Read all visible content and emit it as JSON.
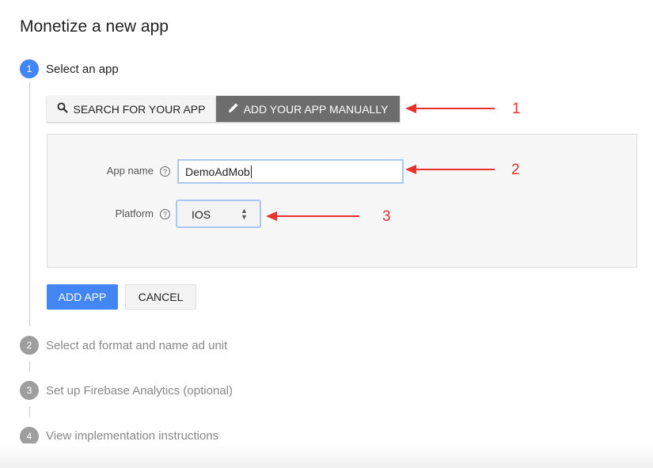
{
  "title": "Monetize a new app",
  "steps": [
    {
      "number": "1",
      "label": "Select an app",
      "active": true
    },
    {
      "number": "2",
      "label": "Select ad format and name ad unit"
    },
    {
      "number": "3",
      "label": "Set up Firebase Analytics (optional)"
    },
    {
      "number": "4",
      "label": "View implementation instructions"
    }
  ],
  "tabs": {
    "search": "SEARCH FOR YOUR APP",
    "manual": "ADD YOUR APP MANUALLY"
  },
  "form": {
    "app_name_label": "App name",
    "app_name_value": "DemoAdMob",
    "platform_label": "Platform",
    "platform_value": "IOS",
    "help": "?"
  },
  "buttons": {
    "add": "ADD APP",
    "cancel": "CANCEL"
  },
  "annotations": [
    "1",
    "2",
    "3"
  ],
  "colors": {
    "accent": "#4285f4",
    "annotation": "#e8322e",
    "active_tab": "#6d6d6d"
  }
}
